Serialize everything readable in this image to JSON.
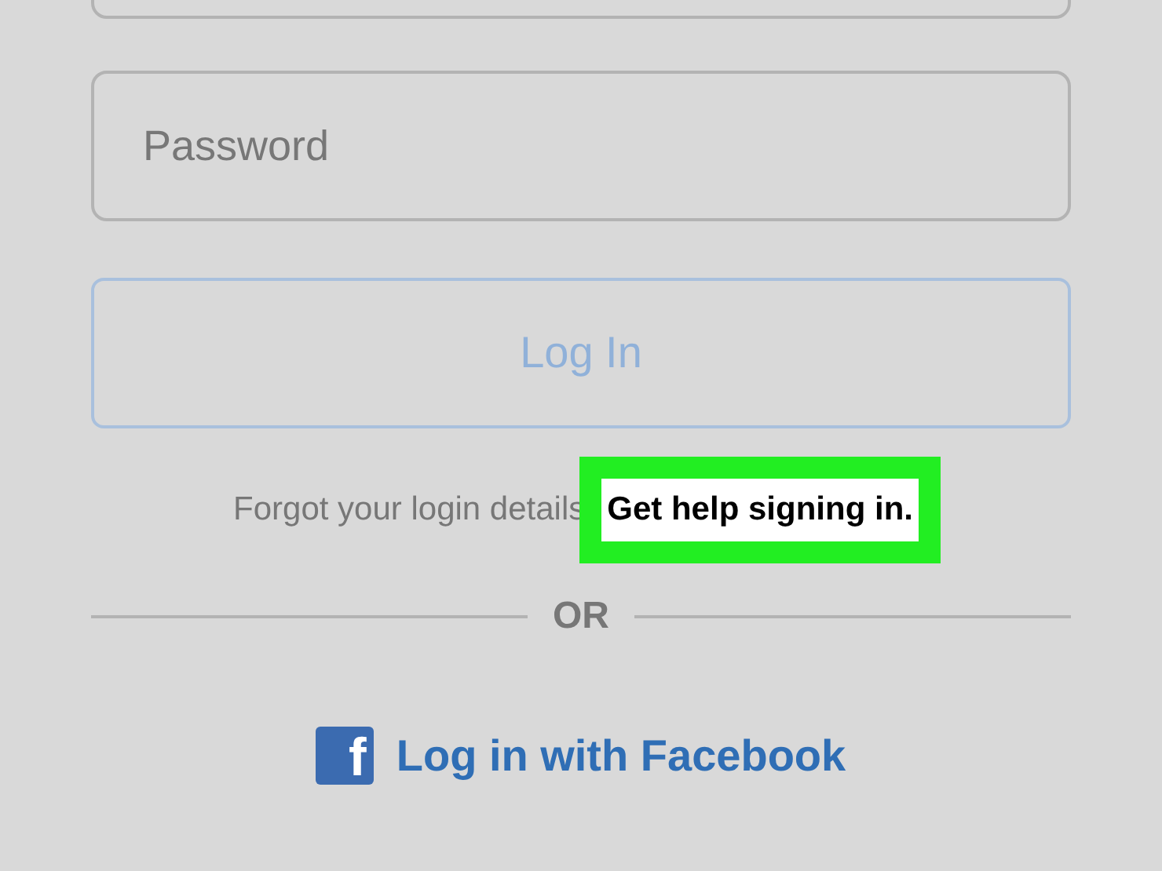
{
  "password_field": {
    "placeholder": "Password"
  },
  "login_button": {
    "label": "Log In",
    "disabled": true
  },
  "forgot": {
    "text": "Forgot your login details",
    "link": "Get help signing in.",
    "highlighted": true
  },
  "divider": {
    "label": "OR"
  },
  "facebook": {
    "label": "Log in with Facebook",
    "icon": "f"
  }
}
